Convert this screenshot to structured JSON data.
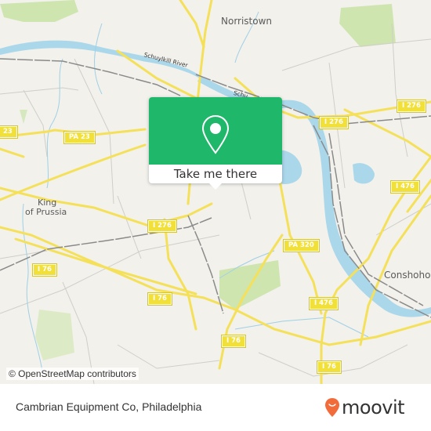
{
  "map": {
    "places": [
      {
        "name": "Norristown",
        "id": "norristown"
      },
      {
        "name": "King",
        "id": "king"
      },
      {
        "name": "of Prussia",
        "id": "of-prussia"
      },
      {
        "name": "Conshohocken",
        "id": "conshohocken"
      }
    ],
    "river_labels": [
      "Schuylkill River",
      "Schu"
    ],
    "shields": [
      {
        "label": "PA 23"
      },
      {
        "label": "23"
      },
      {
        "label": "I 276"
      },
      {
        "label": "I 276"
      },
      {
        "label": "I 276"
      },
      {
        "label": "I 476"
      },
      {
        "label": "I 476"
      },
      {
        "label": "PA 320"
      },
      {
        "label": "I 76"
      },
      {
        "label": "I 76"
      },
      {
        "label": "I 76"
      },
      {
        "label": "I 76"
      }
    ],
    "colors": {
      "land": "#f2f1ec",
      "water": "#aad7ea",
      "park": "#cfe5b0",
      "highway": "#f5e05a",
      "rail": "#8a8a8a"
    }
  },
  "popup": {
    "cta_label": "Take me there",
    "icon": "location-pin-icon",
    "color": "#1fb86a"
  },
  "attribution": "© OpenStreetMap contributors",
  "footer": {
    "title": "Cambrian Equipment Co, Philadelphia",
    "brand": "moovit",
    "brand_color": "#f26b3a"
  }
}
